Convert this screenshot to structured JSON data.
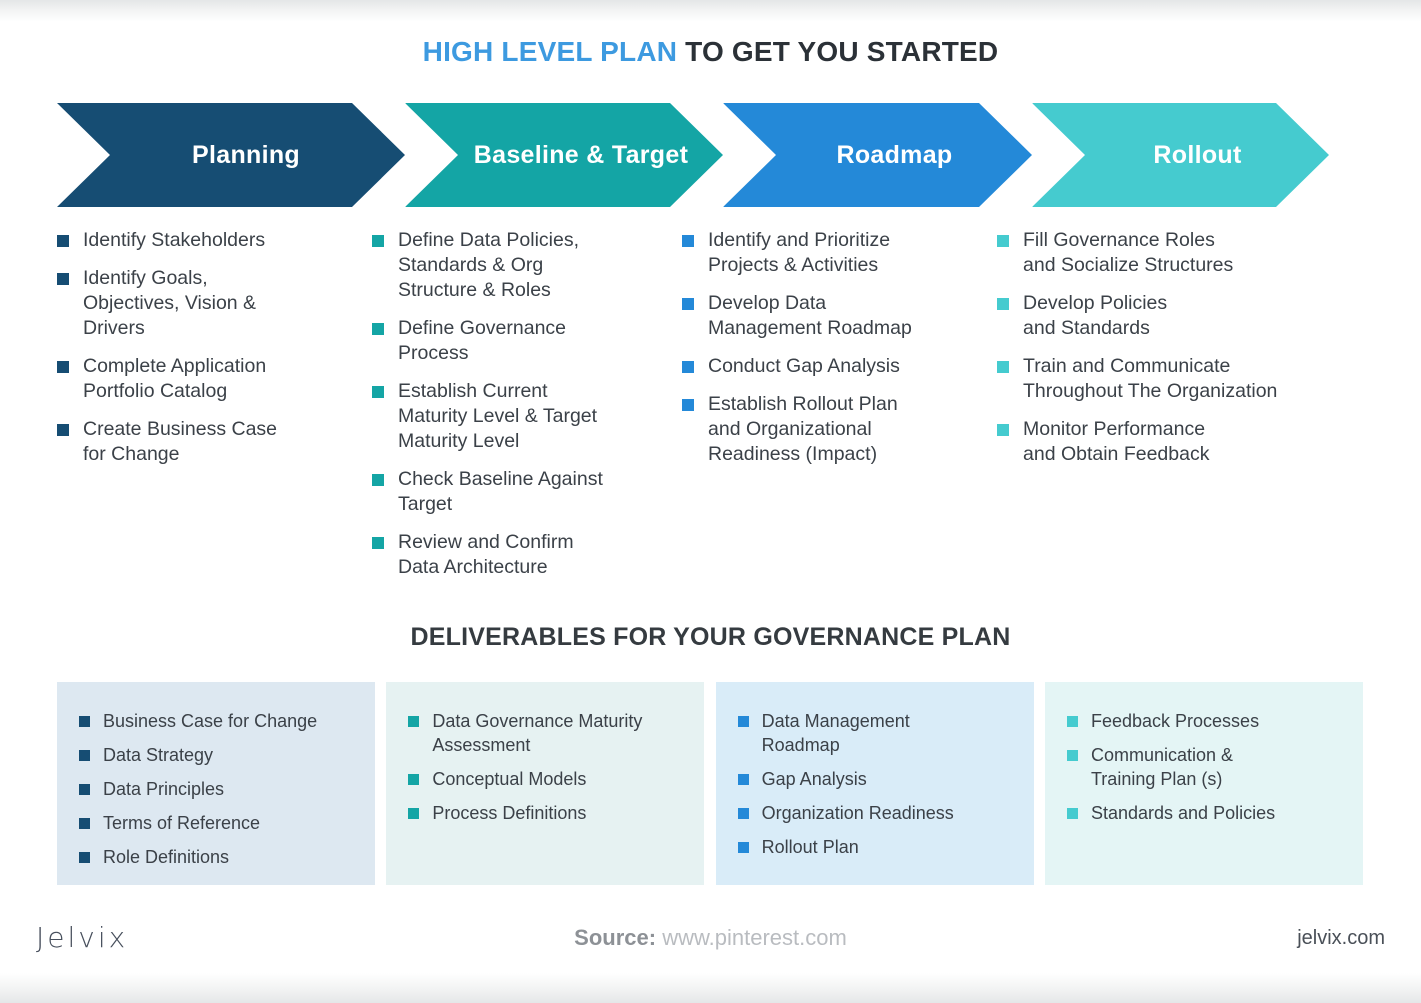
{
  "title": {
    "accent": "HIGH LEVEL PLAN",
    "rest": " TO GET YOU STARTED"
  },
  "colors": {
    "phase1": "#164d73",
    "phase2": "#14a5a5",
    "phase3": "#2489d8",
    "phase4": "#45cbcf",
    "title_accent": "#3d9ae0",
    "box1_bg": "#dde8f1",
    "box2_bg": "#e6f2f2",
    "box3_bg": "#d9ecf8",
    "box4_bg": "#e4f5f5"
  },
  "phases": [
    {
      "label": "Planning",
      "color": "#164d73",
      "items": [
        "Identify Stakeholders",
        "Identify Goals,\nObjectives, Vision &\nDrivers",
        "Complete Application\nPortfolio Catalog",
        "Create Business Case\nfor Change"
      ]
    },
    {
      "label": "Baseline & Target",
      "color": "#14a5a5",
      "items": [
        "Define Data Policies,\nStandards & Org\nStructure & Roles",
        "Define Governance\nProcess",
        "Establish Current\nMaturity Level & Target\nMaturity Level",
        "Check Baseline Against\nTarget",
        "Review and Confirm\nData Architecture"
      ]
    },
    {
      "label": "Roadmap",
      "color": "#2489d8",
      "items": [
        "Identify and Prioritize\nProjects & Activities",
        "Develop Data\nManagement Roadmap",
        "Conduct Gap Analysis",
        "Establish Rollout Plan\nand Organizational\nReadiness (Impact)"
      ]
    },
    {
      "label": "Rollout",
      "color": "#45cbcf",
      "items": [
        "Fill Governance Roles\nand Socialize Structures",
        "Develop Policies\nand Standards",
        "Train and Communicate\nThroughout The Organization",
        "Monitor Performance\nand Obtain Feedback"
      ]
    }
  ],
  "deliverables": {
    "heading": "DELIVERABLES FOR YOUR GOVERNANCE PLAN",
    "boxes": [
      {
        "bg": "#dde8f1",
        "marker": "#164d73",
        "items": [
          "Business Case for Change",
          "Data Strategy",
          "Data Principles",
          "Terms of Reference",
          "Role Definitions"
        ]
      },
      {
        "bg": "#e6f2f2",
        "marker": "#14a5a5",
        "items": [
          "Data Governance Maturity\nAssessment",
          "Conceptual Models",
          "Process Definitions"
        ]
      },
      {
        "bg": "#d9ecf8",
        "marker": "#2489d8",
        "items": [
          "Data Management\nRoadmap",
          "Gap Analysis",
          "Organization Readiness",
          "Rollout Plan"
        ]
      },
      {
        "bg": "#e4f5f5",
        "marker": "#45cbcf",
        "items": [
          "Feedback Processes",
          "Communication &\nTraining Plan (s)",
          "Standards and Policies"
        ]
      }
    ]
  },
  "footer": {
    "logo": "Jelvix",
    "source_label": "Source:",
    "source_url": " www.pinterest.com",
    "site": "jelvix.com"
  }
}
